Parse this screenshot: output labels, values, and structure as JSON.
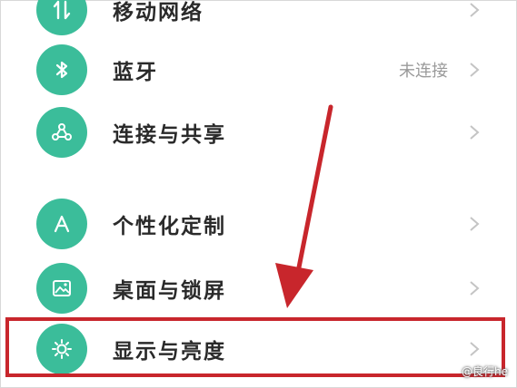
{
  "settings": {
    "items": [
      {
        "label": "移动网络",
        "icon": "mobile-data-icon",
        "value": ""
      },
      {
        "label": "蓝牙",
        "icon": "bluetooth-icon",
        "value": "未连接"
      },
      {
        "label": "连接与共享",
        "icon": "share-network-icon",
        "value": ""
      },
      {
        "label": "个性化定制",
        "icon": "personalize-icon",
        "value": ""
      },
      {
        "label": "桌面与锁屏",
        "icon": "wallpaper-icon",
        "value": ""
      },
      {
        "label": "显示与亮度",
        "icon": "brightness-icon",
        "value": ""
      }
    ]
  },
  "annotation": {
    "highlight_color": "#c8262c",
    "arrow_color": "#c8262c"
  },
  "theme": {
    "icon_bg": "#3bbd9a"
  },
  "watermark": {
    "text": "@良行he"
  }
}
